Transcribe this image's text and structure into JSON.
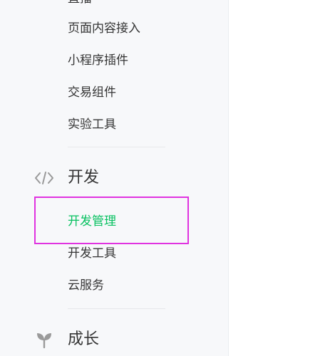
{
  "sidebar": {
    "top_items": [
      {
        "label": "直播"
      },
      {
        "label": "页面内容接入"
      },
      {
        "label": "小程序插件"
      },
      {
        "label": "交易组件"
      },
      {
        "label": "实验工具"
      }
    ],
    "sections": [
      {
        "title": "开发",
        "icon": "code-icon",
        "items": [
          {
            "label": "开发管理",
            "active": true
          },
          {
            "label": "开发工具"
          },
          {
            "label": "云服务"
          }
        ]
      },
      {
        "title": "成长",
        "icon": "sprout-icon",
        "items": []
      }
    ]
  },
  "colors": {
    "sidebar_bg": "#f7f8fa",
    "text": "#353535",
    "active": "#07c160",
    "icon": "#9a9a9a",
    "highlight_border": "#e033e0"
  }
}
